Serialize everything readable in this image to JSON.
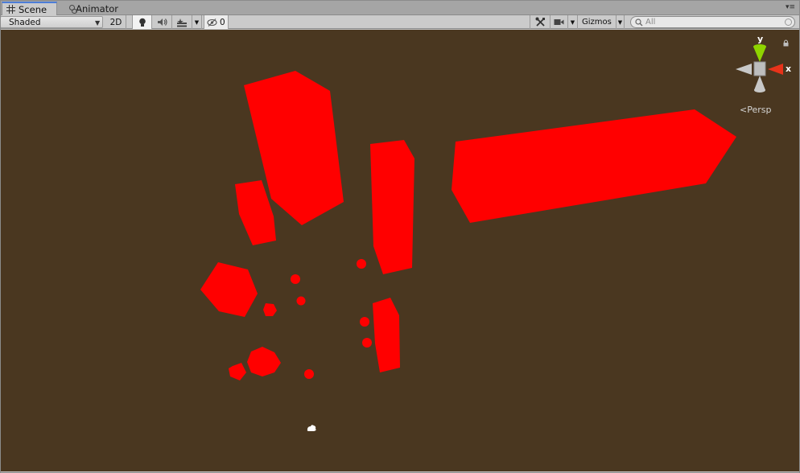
{
  "tabs": [
    {
      "label": "Scene",
      "icon": "grid-icon",
      "active": true
    },
    {
      "label": "Animator",
      "icon": "animator-icon",
      "active": false
    }
  ],
  "toolbar": {
    "shading_mode": "Shaded",
    "mode_2d_label": "2D",
    "lighting_icon": "lightbulb-icon",
    "audio_icon": "speaker-icon",
    "effects_icon": "effects-icon",
    "hidden_icon": "eye-slash-icon",
    "hidden_count": "0",
    "tools_icon": "tools-icon",
    "camera_icon": "camera-icon",
    "gizmos_label": "Gizmos",
    "search_placeholder": "All"
  },
  "gizmo": {
    "y_label": "y",
    "x_label": "x",
    "projection_label": "Persp",
    "colors": {
      "y": "#8fd400",
      "x": "#e8331a",
      "neutral": "#c8c8c8"
    }
  },
  "scene": {
    "background_color": "#4a3720",
    "object_color": "#ff0000"
  }
}
